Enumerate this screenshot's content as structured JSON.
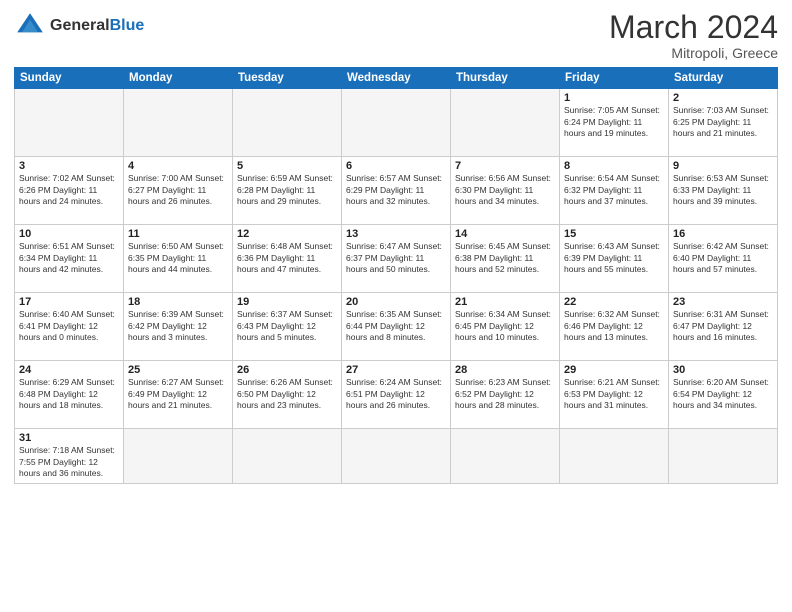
{
  "header": {
    "logo_general": "General",
    "logo_blue": "Blue",
    "title": "March 2024",
    "subtitle": "Mitropoli, Greece"
  },
  "weekdays": [
    "Sunday",
    "Monday",
    "Tuesday",
    "Wednesday",
    "Thursday",
    "Friday",
    "Saturday"
  ],
  "weeks": [
    [
      {
        "day": "",
        "info": ""
      },
      {
        "day": "",
        "info": ""
      },
      {
        "day": "",
        "info": ""
      },
      {
        "day": "",
        "info": ""
      },
      {
        "day": "",
        "info": ""
      },
      {
        "day": "1",
        "info": "Sunrise: 7:05 AM\nSunset: 6:24 PM\nDaylight: 11 hours and 19 minutes."
      },
      {
        "day": "2",
        "info": "Sunrise: 7:03 AM\nSunset: 6:25 PM\nDaylight: 11 hours and 21 minutes."
      }
    ],
    [
      {
        "day": "3",
        "info": "Sunrise: 7:02 AM\nSunset: 6:26 PM\nDaylight: 11 hours and 24 minutes."
      },
      {
        "day": "4",
        "info": "Sunrise: 7:00 AM\nSunset: 6:27 PM\nDaylight: 11 hours and 26 minutes."
      },
      {
        "day": "5",
        "info": "Sunrise: 6:59 AM\nSunset: 6:28 PM\nDaylight: 11 hours and 29 minutes."
      },
      {
        "day": "6",
        "info": "Sunrise: 6:57 AM\nSunset: 6:29 PM\nDaylight: 11 hours and 32 minutes."
      },
      {
        "day": "7",
        "info": "Sunrise: 6:56 AM\nSunset: 6:30 PM\nDaylight: 11 hours and 34 minutes."
      },
      {
        "day": "8",
        "info": "Sunrise: 6:54 AM\nSunset: 6:32 PM\nDaylight: 11 hours and 37 minutes."
      },
      {
        "day": "9",
        "info": "Sunrise: 6:53 AM\nSunset: 6:33 PM\nDaylight: 11 hours and 39 minutes."
      }
    ],
    [
      {
        "day": "10",
        "info": "Sunrise: 6:51 AM\nSunset: 6:34 PM\nDaylight: 11 hours and 42 minutes."
      },
      {
        "day": "11",
        "info": "Sunrise: 6:50 AM\nSunset: 6:35 PM\nDaylight: 11 hours and 44 minutes."
      },
      {
        "day": "12",
        "info": "Sunrise: 6:48 AM\nSunset: 6:36 PM\nDaylight: 11 hours and 47 minutes."
      },
      {
        "day": "13",
        "info": "Sunrise: 6:47 AM\nSunset: 6:37 PM\nDaylight: 11 hours and 50 minutes."
      },
      {
        "day": "14",
        "info": "Sunrise: 6:45 AM\nSunset: 6:38 PM\nDaylight: 11 hours and 52 minutes."
      },
      {
        "day": "15",
        "info": "Sunrise: 6:43 AM\nSunset: 6:39 PM\nDaylight: 11 hours and 55 minutes."
      },
      {
        "day": "16",
        "info": "Sunrise: 6:42 AM\nSunset: 6:40 PM\nDaylight: 11 hours and 57 minutes."
      }
    ],
    [
      {
        "day": "17",
        "info": "Sunrise: 6:40 AM\nSunset: 6:41 PM\nDaylight: 12 hours and 0 minutes."
      },
      {
        "day": "18",
        "info": "Sunrise: 6:39 AM\nSunset: 6:42 PM\nDaylight: 12 hours and 3 minutes."
      },
      {
        "day": "19",
        "info": "Sunrise: 6:37 AM\nSunset: 6:43 PM\nDaylight: 12 hours and 5 minutes."
      },
      {
        "day": "20",
        "info": "Sunrise: 6:35 AM\nSunset: 6:44 PM\nDaylight: 12 hours and 8 minutes."
      },
      {
        "day": "21",
        "info": "Sunrise: 6:34 AM\nSunset: 6:45 PM\nDaylight: 12 hours and 10 minutes."
      },
      {
        "day": "22",
        "info": "Sunrise: 6:32 AM\nSunset: 6:46 PM\nDaylight: 12 hours and 13 minutes."
      },
      {
        "day": "23",
        "info": "Sunrise: 6:31 AM\nSunset: 6:47 PM\nDaylight: 12 hours and 16 minutes."
      }
    ],
    [
      {
        "day": "24",
        "info": "Sunrise: 6:29 AM\nSunset: 6:48 PM\nDaylight: 12 hours and 18 minutes."
      },
      {
        "day": "25",
        "info": "Sunrise: 6:27 AM\nSunset: 6:49 PM\nDaylight: 12 hours and 21 minutes."
      },
      {
        "day": "26",
        "info": "Sunrise: 6:26 AM\nSunset: 6:50 PM\nDaylight: 12 hours and 23 minutes."
      },
      {
        "day": "27",
        "info": "Sunrise: 6:24 AM\nSunset: 6:51 PM\nDaylight: 12 hours and 26 minutes."
      },
      {
        "day": "28",
        "info": "Sunrise: 6:23 AM\nSunset: 6:52 PM\nDaylight: 12 hours and 28 minutes."
      },
      {
        "day": "29",
        "info": "Sunrise: 6:21 AM\nSunset: 6:53 PM\nDaylight: 12 hours and 31 minutes."
      },
      {
        "day": "30",
        "info": "Sunrise: 6:20 AM\nSunset: 6:54 PM\nDaylight: 12 hours and 34 minutes."
      }
    ],
    [
      {
        "day": "31",
        "info": "Sunrise: 7:18 AM\nSunset: 7:55 PM\nDaylight: 12 hours and 36 minutes."
      },
      {
        "day": "",
        "info": ""
      },
      {
        "day": "",
        "info": ""
      },
      {
        "day": "",
        "info": ""
      },
      {
        "day": "",
        "info": ""
      },
      {
        "day": "",
        "info": ""
      },
      {
        "day": "",
        "info": ""
      }
    ]
  ]
}
